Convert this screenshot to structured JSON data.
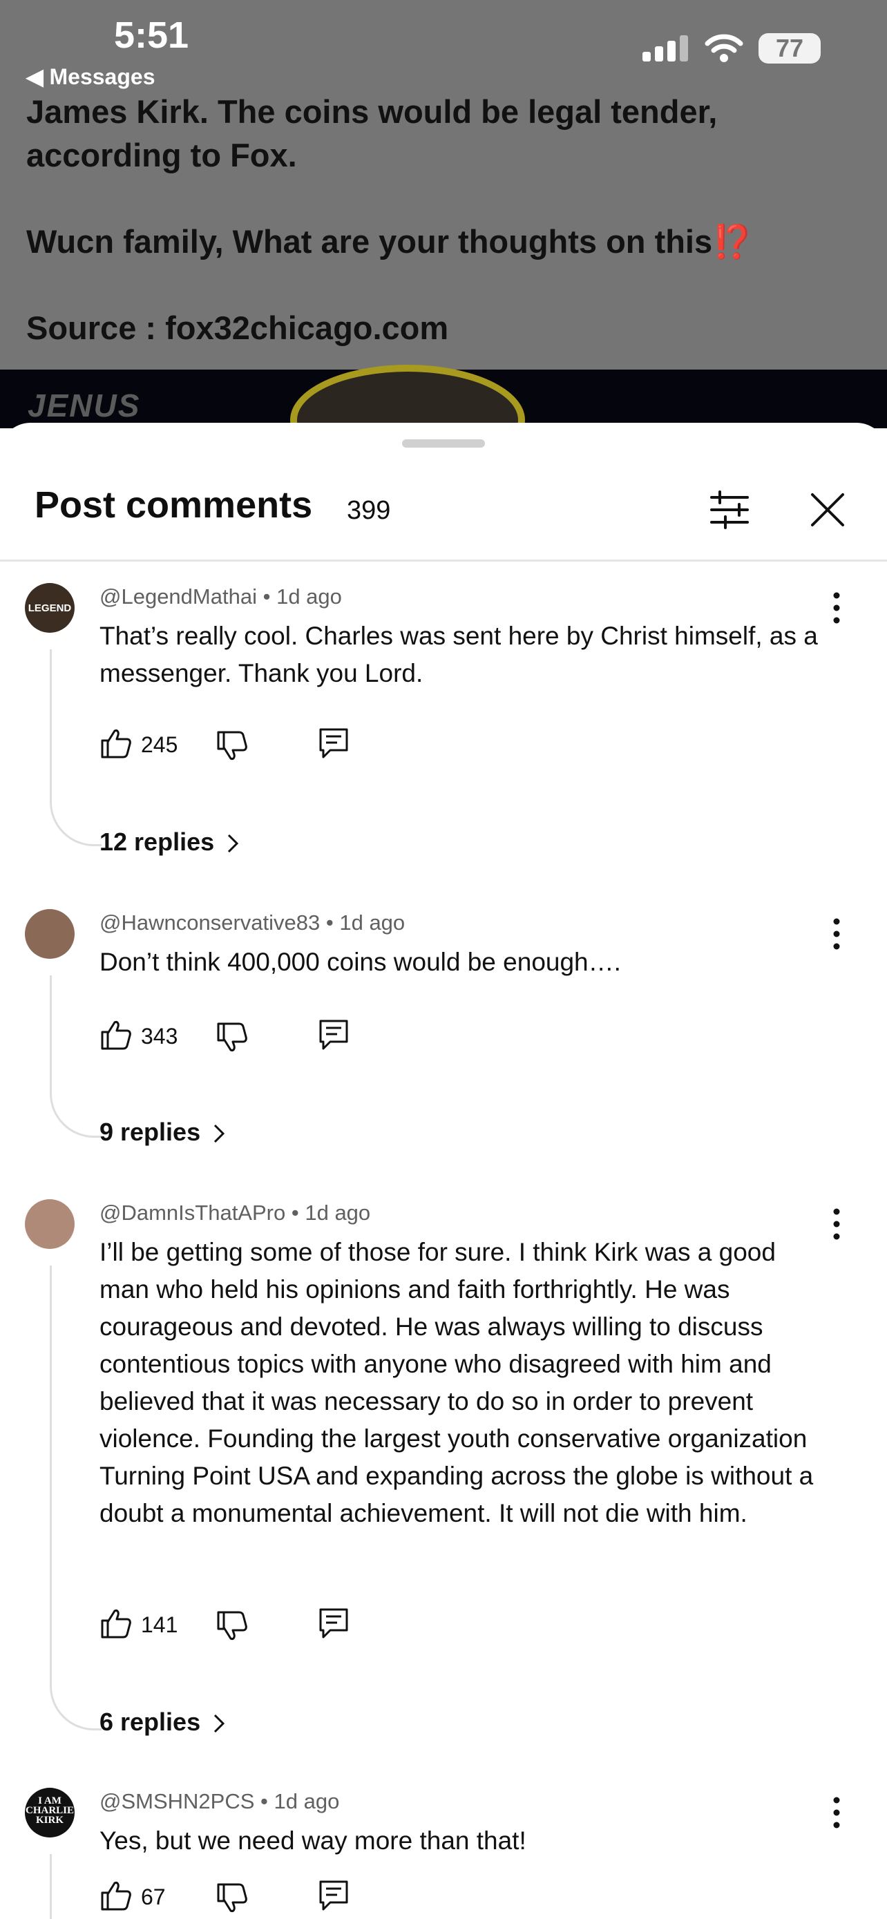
{
  "status_bar": {
    "time": "5:51",
    "back_label": "◀ Messages",
    "battery": "77"
  },
  "post": {
    "line1": "James Kirk. The coins would be legal tender,",
    "line2": "according to Fox.",
    "line3": "Wucn family, What are your thoughts on this",
    "line3_emoji": "⁉️",
    "line4": "Source : fox32chicago.com",
    "thumbnail_logo": "JENUS"
  },
  "sheet": {
    "title": "Post comments",
    "count": "399"
  },
  "comments": [
    {
      "avatar_text": "LEGEND",
      "author": "@LegendMathai",
      "age": "1d ago",
      "text": "That’s really cool. Charles was sent here by Christ himself, as a messenger.  Thank you Lord.",
      "likes": "245",
      "replies": "12 replies"
    },
    {
      "avatar_text": "",
      "author": "@Hawnconservative83",
      "age": "1d ago",
      "text": "Don’t think 400,000 coins would be enough….",
      "likes": "343",
      "replies": "9 replies"
    },
    {
      "avatar_text": "",
      "author": "@DamnIsThatAPro",
      "age": "1d ago",
      "text": "I’ll be getting some of those for sure. I think Kirk was a good man who held his opinions and faith forthrightly. He was courageous and devoted. He was always willing to discuss contentious topics with anyone who disagreed with him and believed that it was necessary to do so in order to prevent violence. Founding the largest youth conservative organization Turning Point USA and expanding across the globe is without a doubt a monumental achievement. It will not die with him.",
      "likes": "141",
      "replies": "6 replies"
    },
    {
      "avatar_text": "I AM CHARLIE KIRK",
      "author": "@SMSHN2PCS",
      "age": "1d ago",
      "text": "Yes, but we need way more than that!",
      "likes": "67",
      "replies": ""
    }
  ],
  "meta_separator": "•"
}
